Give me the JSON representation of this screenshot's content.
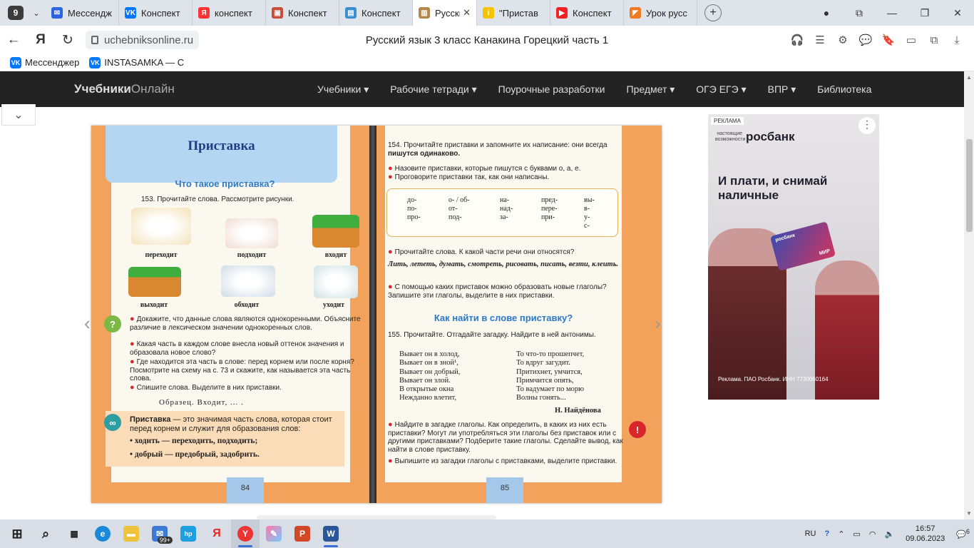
{
  "browser": {
    "tab_count": "9",
    "tabs": [
      {
        "label": "Мессендж",
        "color": "#2b63e0",
        "glyph": "✉"
      },
      {
        "label": "Конспект",
        "color": "#0077ff",
        "glyph": "VK"
      },
      {
        "label": "конспект",
        "color": "#f33",
        "glyph": "Я"
      },
      {
        "label": "Конспект",
        "color": "#c94d3a",
        "glyph": "▣"
      },
      {
        "label": "Конспект",
        "color": "#3a8fd0",
        "glyph": "▤"
      },
      {
        "label": "Русски",
        "color": "#b3884a",
        "glyph": "▥",
        "active": true
      },
      {
        "label": "\"Пристав",
        "color": "#f4c400",
        "glyph": "i"
      },
      {
        "label": "Конспект",
        "color": "#e22",
        "glyph": "▶"
      },
      {
        "label": "Урок русс",
        "color": "#f07c21",
        "glyph": "◤"
      }
    ],
    "url": "uchebniksonline.ru",
    "page_title": "Русский язык 3 класс Канакина Горецкий часть 1",
    "bookmarks": [
      {
        "label": "Мессенджер"
      },
      {
        "label": "INSTASAMKA — С"
      }
    ]
  },
  "site": {
    "logo_bold": "Учебники",
    "logo_light": "Онлайн",
    "menu": [
      {
        "label": "Учебники ▾"
      },
      {
        "label": "Рабочие тетради ▾"
      },
      {
        "label": "Поурочные разработки"
      },
      {
        "label": "Предмет ▾"
      },
      {
        "label": "ОГЭ ЕГЭ ▾"
      },
      {
        "label": "ВПР ▾"
      },
      {
        "label": "Библиотека"
      }
    ]
  },
  "book": {
    "left": {
      "title": "Приставка",
      "subtitle": "Что такое приставка?",
      "ex153": "153. Прочитайте слова. Рассмотрите рисунки.",
      "captions": [
        "переходит",
        "подходит",
        "входит",
        "выходит",
        "обходит",
        "уходит"
      ],
      "q1": "Докажите, что данные слова являются однокоренными. Объясните различие в лексическом значении однокоренных слов.",
      "q2": "Какая часть в каждом слове внесла новый оттенок значения и образовала новое слово?",
      "q3": "Где находится эта часть в слове: перед корнем или после корня? Посмотрите на схему на с. 73 и скажите, как называется эта часть слова.",
      "q4": "Спишите слова. Выделите в них приставки.",
      "sample": "Образец. Входит, ... .",
      "rule_term": "Приставка",
      "rule_text": " — это значимая часть слова, которая стоит перед корнем и служит для образования слов:",
      "rule_ex1": "• ходить — переходить, подходить;",
      "rule_ex2": "• добрый — предобрый, задобрить.",
      "page_number": "84"
    },
    "right": {
      "ex154": "154. Прочитайте приставки и запомните их написание: они всегда ",
      "ex154_bold": "пишутся одинаково.",
      "b1": "Назовите приставки, которые пишутся с буквами о, а, е.",
      "b2": "Проговорите приставки так, как они написаны.",
      "prefix_cols": [
        "до-\nпо-\nпро-",
        "о- / об-\nот-\nпод-",
        "на-\nнад-\nза-",
        "пред-\nпере-\nпри-",
        "вы-\nв-\nу-\nс-"
      ],
      "b3": "Прочитайте слова. К какой части речи они относятся?",
      "verbs": "Лить, лететь, думать, смотреть, рисовать, писать, везти, клеить.",
      "b4": "С помощью каких приставок можно образовать новые глаголы? Запишите эти глаголы, выделите в них приставки.",
      "subtitle": "Как найти в слове приставку?",
      "ex155": "155. Прочитайте. Отгадайте загадку. Найдите в ней антонимы.",
      "riddle_left": "Вывает он в холод,\nВывает он в зной¹,\nВывает он добрый,\nВывает он злой.\nВ открытые окна\nНежданно влетит,",
      "riddle_right": "То что-то прошепчет,\nТо вдруг загудит.\nПритихнет, умчится,\nПримчится опять,\nТо вадумает по морю\nВолны гонять...",
      "author": "Н. Найдёнова",
      "b5": "Найдите в загадке глаголы. Как определить, в каких из них есть приставки? Могут ли употребляться эти глаголы без приставок или с другими приставками? Подберите такие глаголы. Сделайте вывод, как найти в слове приставку.",
      "b6": "Выпишите из загадки глаголы с приставками, выделите приставки.",
      "page_number": "85"
    }
  },
  "ad": {
    "tag": "РЕКЛАМА",
    "small": "настоящие возможности",
    "brand": "росбанк",
    "headline": "И плати, и снимай наличные",
    "card_label": "росбанк",
    "card_mir": "МИР",
    "footer": "Реклама. ПАО Росбанк. ИНН 7730060164"
  },
  "taskbar": {
    "mail_badge": "99+",
    "lang": "RU",
    "time": "16:57",
    "date": "09.06.2023",
    "notif": "6"
  }
}
